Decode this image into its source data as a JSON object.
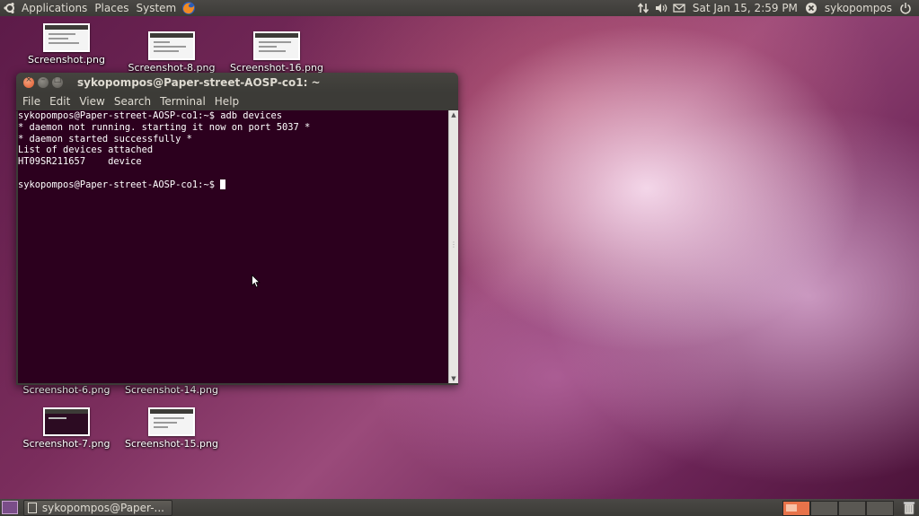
{
  "top_panel": {
    "menus": [
      "Applications",
      "Places",
      "System"
    ],
    "datetime": "Sat Jan 15,  2:59 PM",
    "username": "sykopompos",
    "icons": [
      "ubuntu-logo-icon",
      "firefox-icon",
      "network-arrows-icon",
      "volume-icon",
      "mail-envelope-icon",
      "user-status-icon",
      "power-icon"
    ]
  },
  "desktop": {
    "icons": [
      {
        "label": "Screenshot.png"
      },
      {
        "label": "Screenshot-8.png"
      },
      {
        "label": "Screenshot-16.png"
      },
      {
        "label": "Screenshot-6.png"
      },
      {
        "label": "Screenshot-14.png"
      },
      {
        "label": "Screenshot-7.png"
      },
      {
        "label": "Screenshot-15.png"
      }
    ]
  },
  "terminal": {
    "title": "sykopompos@Paper-street-AOSP-co1: ~",
    "menu": [
      "File",
      "Edit",
      "View",
      "Search",
      "Terminal",
      "Help"
    ],
    "lines": [
      "sykopompos@Paper-street-AOSP-co1:~$ adb devices",
      "* daemon not running. starting it now on port 5037 *",
      "* daemon started successfully *",
      "List of devices attached",
      "HT09SR211657    device",
      "",
      "sykopompos@Paper-street-AOSP-co1:~$ "
    ]
  },
  "bottom_panel": {
    "task_label": "sykopompos@Paper-...",
    "accent": "#e8734a"
  }
}
